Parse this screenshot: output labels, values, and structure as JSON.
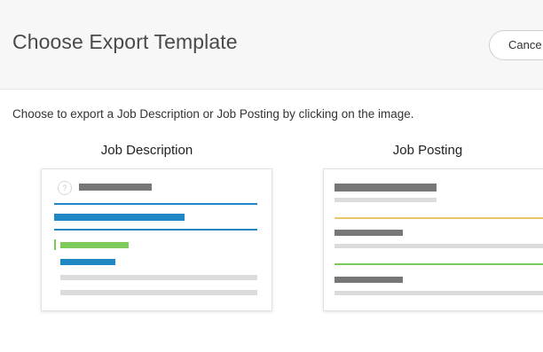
{
  "dialog": {
    "title": "Choose Export Template",
    "cancel_label": "Cance",
    "instructions": "Choose to export a Job Description or Job Posting by clicking on the image."
  },
  "options": [
    {
      "label": "Job Description",
      "thumbnail_icon": "question-mark-icon"
    },
    {
      "label": "Job Posting"
    }
  ],
  "colors": {
    "header_bg": "#f7f7f7",
    "blue": "#1f87c4",
    "green": "#7ccb5b",
    "yellow": "#e8c46a",
    "gray_dark": "#777777",
    "gray_light": "#dcdcdc"
  },
  "icons": {
    "help": "?"
  }
}
